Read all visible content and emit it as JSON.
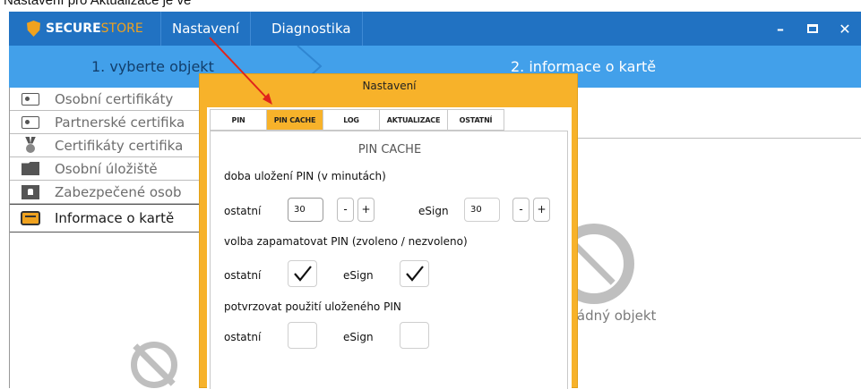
{
  "caption": "Nastavení pro Aktualizace je ve",
  "menubar": {
    "logo_bold": "SECURE",
    "logo_light": "STORE",
    "menu": [
      "Nastavení",
      "Diagnostika"
    ]
  },
  "steps": {
    "step1": "1. vyberte objekt",
    "step2": "2. informace o kartě"
  },
  "sidebar": {
    "items": [
      {
        "label": "Osobní certifikáty",
        "icon": "personal-certificate-icon"
      },
      {
        "label": "Partnerské certifika",
        "icon": "partner-certificate-icon"
      },
      {
        "label": "Certifikáty certifika",
        "icon": "medal-icon"
      },
      {
        "label": "Osobní úložiště",
        "icon": "folder-icon"
      },
      {
        "label": "Zabezpečené osob",
        "icon": "lock-folder-icon"
      },
      {
        "label": "Informace o kartě",
        "icon": "wallet-card-icon",
        "active": true
      }
    ]
  },
  "main": {
    "empty_text": "žádný objekt"
  },
  "dialog": {
    "title": "Nastavení",
    "tabs": [
      "PIN",
      "PIN CACHE",
      "LOG",
      "AKTUALIZACE",
      "OSTATNÍ"
    ],
    "active_tab": "PIN CACHE",
    "panel_title": "PIN CACHE",
    "section1": "doba uložení PIN (v minutách)",
    "label_other": "ostatní",
    "label_esign": "eSign",
    "other_value": "30",
    "esign_value": "30",
    "minus": "-",
    "plus": "+",
    "section2": "volba zapamatovat PIN (zvoleno / nezvoleno)",
    "remember_other_checked": true,
    "remember_esign_checked": true,
    "section3": "potvrzovat použití uloženého PIN",
    "confirm_other_checked": false,
    "confirm_esign_checked": false
  },
  "colors": {
    "menubar": "#2172c2",
    "stepbar": "#42a0ea",
    "dialog": "#f7b22a",
    "annotation_arrow": "#e0241b"
  }
}
